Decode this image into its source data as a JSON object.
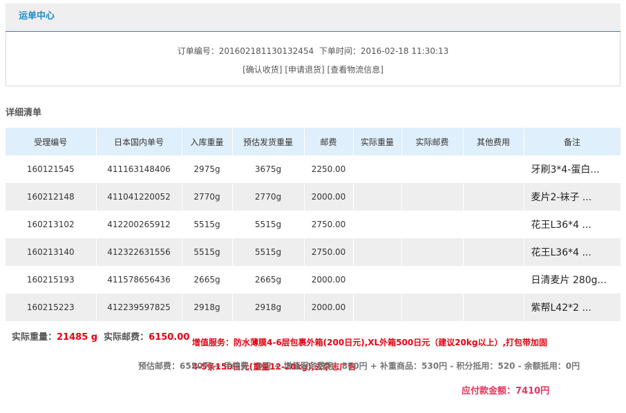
{
  "header": {
    "title": "运单中心"
  },
  "order": {
    "number_label": "订单编号：",
    "number": "201602181130132454",
    "time_label": "下单时间：",
    "time": "2016-02-18 11:30:13"
  },
  "actions": [
    {
      "label": "[确认收货]"
    },
    {
      "label": "[申请退货]"
    },
    {
      "label": "[查看物流信息]"
    }
  ],
  "section_title": "详细清单",
  "table": {
    "headers": [
      "受理编号",
      "日本国内单号",
      "入库重量",
      "预估发货重量",
      "邮费",
      "实际重量",
      "实际邮费",
      "其他费用",
      "备注"
    ],
    "rows": [
      {
        "id": "160121545",
        "jp_no": "411163148406",
        "in_weight": "2975g",
        "est_weight": "3675g",
        "postage": "2250.00",
        "actual_weight": "",
        "actual_postage": "",
        "other": "",
        "note": "牙刷3*4-蛋白..."
      },
      {
        "id": "160212148",
        "jp_no": "411041220052",
        "in_weight": "2770g",
        "est_weight": "2770g",
        "postage": "2000.00",
        "actual_weight": "",
        "actual_postage": "",
        "other": "",
        "note": "麦片2-袜子 ..."
      },
      {
        "id": "160213102",
        "jp_no": "412200265912",
        "in_weight": "5515g",
        "est_weight": "5515g",
        "postage": "2750.00",
        "actual_weight": "",
        "actual_postage": "",
        "other": "",
        "note": "花王L36*4 ..."
      },
      {
        "id": "160213140",
        "jp_no": "412322631556",
        "in_weight": "5515g",
        "est_weight": "5515g",
        "postage": "2750.00",
        "actual_weight": "",
        "actual_postage": "",
        "other": "",
        "note": "花王L36*4 ..."
      },
      {
        "id": "160215193",
        "jp_no": "411578656436",
        "in_weight": "2665g",
        "est_weight": "2665g",
        "postage": "2000.00",
        "actual_weight": "",
        "actual_postage": "",
        "other": "",
        "note": "日清麦片 280g..."
      },
      {
        "id": "160215223",
        "jp_no": "412239597825",
        "in_weight": "2918g",
        "est_weight": "2918g",
        "postage": "2000.00",
        "actual_weight": "",
        "actual_postage": "",
        "other": "",
        "note": "紫帮L42*2 ..."
      }
    ]
  },
  "summary": {
    "actual_weight_label": "实际重量：",
    "actual_weight": "21485 g",
    "actual_postage_label": "实际邮费：",
    "actual_postage": "6150.00",
    "service": "增值服务：防水薄膜4-6层包裹外箱(200日元),XL外箱500日元（建议20kg以上）,打包带加固4-5条150日元(重量12-20kg),去杂志广告",
    "fees": "预估邮费：6550円 + 手续费：0円 + 增值服务费用：850円 + 补重商品：530円 - 积分抵用：520 - 余额抵用：0円",
    "total": "应付款金额：7410円"
  }
}
